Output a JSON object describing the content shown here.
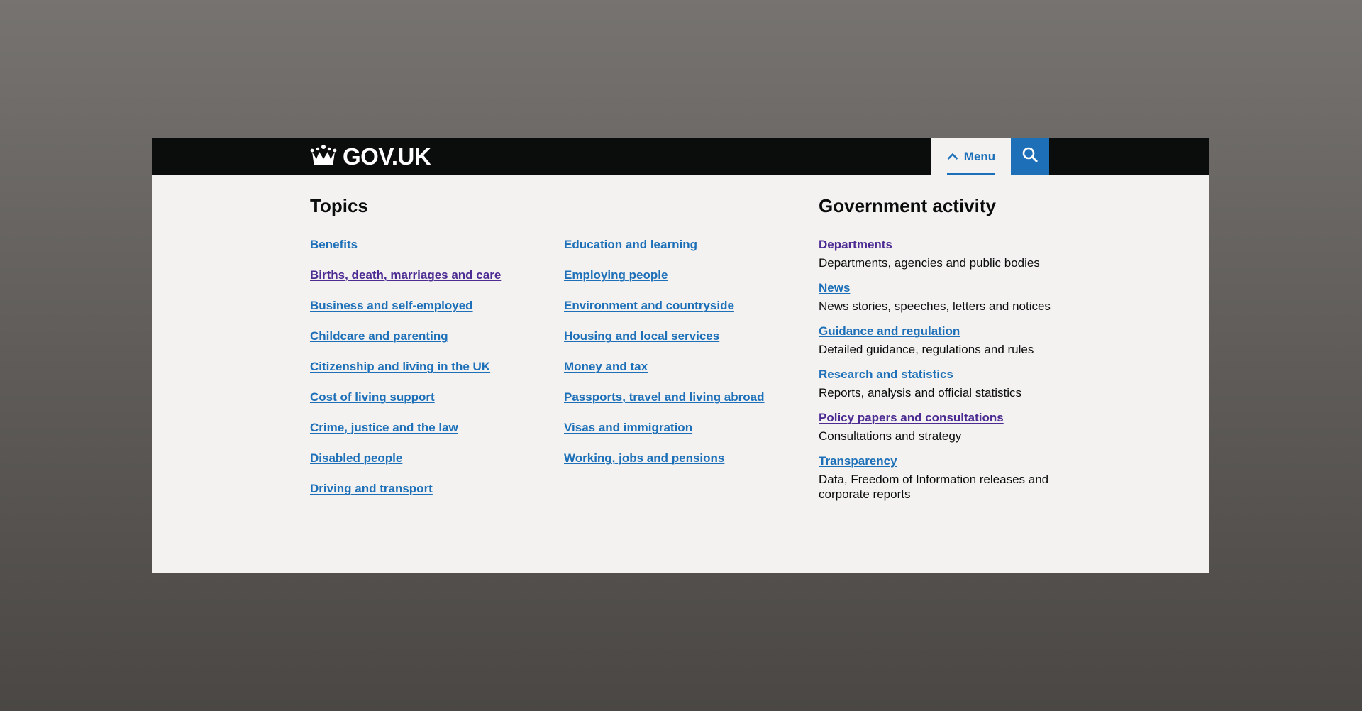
{
  "header": {
    "logo_text": "GOV.UK",
    "menu_label": "Menu",
    "search_icon": "search-icon",
    "crown_icon": "crown-icon",
    "menu_icon": "chevron-up-icon"
  },
  "colors": {
    "header_bg": "#0b0c0c",
    "link": "#1d70b8",
    "visited_link": "#4c2c92",
    "panel_bg": "#f3f2f1",
    "text": "#0b0c0c"
  },
  "topics": {
    "heading": "Topics",
    "column1": [
      {
        "label": "Benefits",
        "visited": false
      },
      {
        "label": "Births, death, marriages and care",
        "visited": true
      },
      {
        "label": "Business and self-employed",
        "visited": false
      },
      {
        "label": "Childcare and parenting",
        "visited": false
      },
      {
        "label": "Citizenship and living in the UK",
        "visited": false
      },
      {
        "label": "Cost of living support",
        "visited": false
      },
      {
        "label": "Crime, justice and the law",
        "visited": false
      },
      {
        "label": "Disabled people",
        "visited": false
      },
      {
        "label": "Driving and transport",
        "visited": false
      }
    ],
    "column2": [
      {
        "label": "Education and learning",
        "visited": false
      },
      {
        "label": "Employing people",
        "visited": false
      },
      {
        "label": "Environment and countryside",
        "visited": false
      },
      {
        "label": "Housing and local services",
        "visited": false
      },
      {
        "label": "Money and tax",
        "visited": false
      },
      {
        "label": "Passports, travel and living abroad",
        "visited": false
      },
      {
        "label": "Visas and immigration",
        "visited": false
      },
      {
        "label": "Working, jobs and pensions",
        "visited": false
      }
    ]
  },
  "government_activity": {
    "heading": "Government activity",
    "items": [
      {
        "label": "Departments",
        "description": "Departments, agencies and public bodies",
        "visited": true
      },
      {
        "label": "News",
        "description": "News stories, speeches, letters and notices",
        "visited": false
      },
      {
        "label": "Guidance and regulation",
        "description": "Detailed guidance, regulations and rules",
        "visited": false
      },
      {
        "label": "Research and statistics",
        "description": "Reports, analysis and official statistics",
        "visited": false
      },
      {
        "label": "Policy papers and consultations",
        "description": "Consultations and strategy",
        "visited": true
      },
      {
        "label": "Transparency",
        "description": "Data, Freedom of Information releases and corporate reports",
        "visited": false
      }
    ]
  }
}
